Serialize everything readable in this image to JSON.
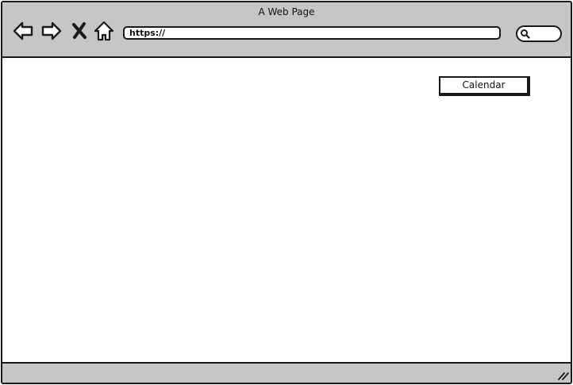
{
  "window": {
    "title": "A Web Page"
  },
  "toolbar": {
    "icons": [
      "back-arrow-icon",
      "forward-arrow-icon",
      "close-icon",
      "home-icon"
    ],
    "url_value": "https://",
    "search_icon": "search-icon"
  },
  "content": {
    "calendar_button_label": "Calendar"
  },
  "statusbar": {
    "resize_icon": "resize-grip-icon"
  },
  "colors": {
    "chrome": "#c6c6c6",
    "border": "#1a1a1a",
    "background": "#ffffff"
  }
}
